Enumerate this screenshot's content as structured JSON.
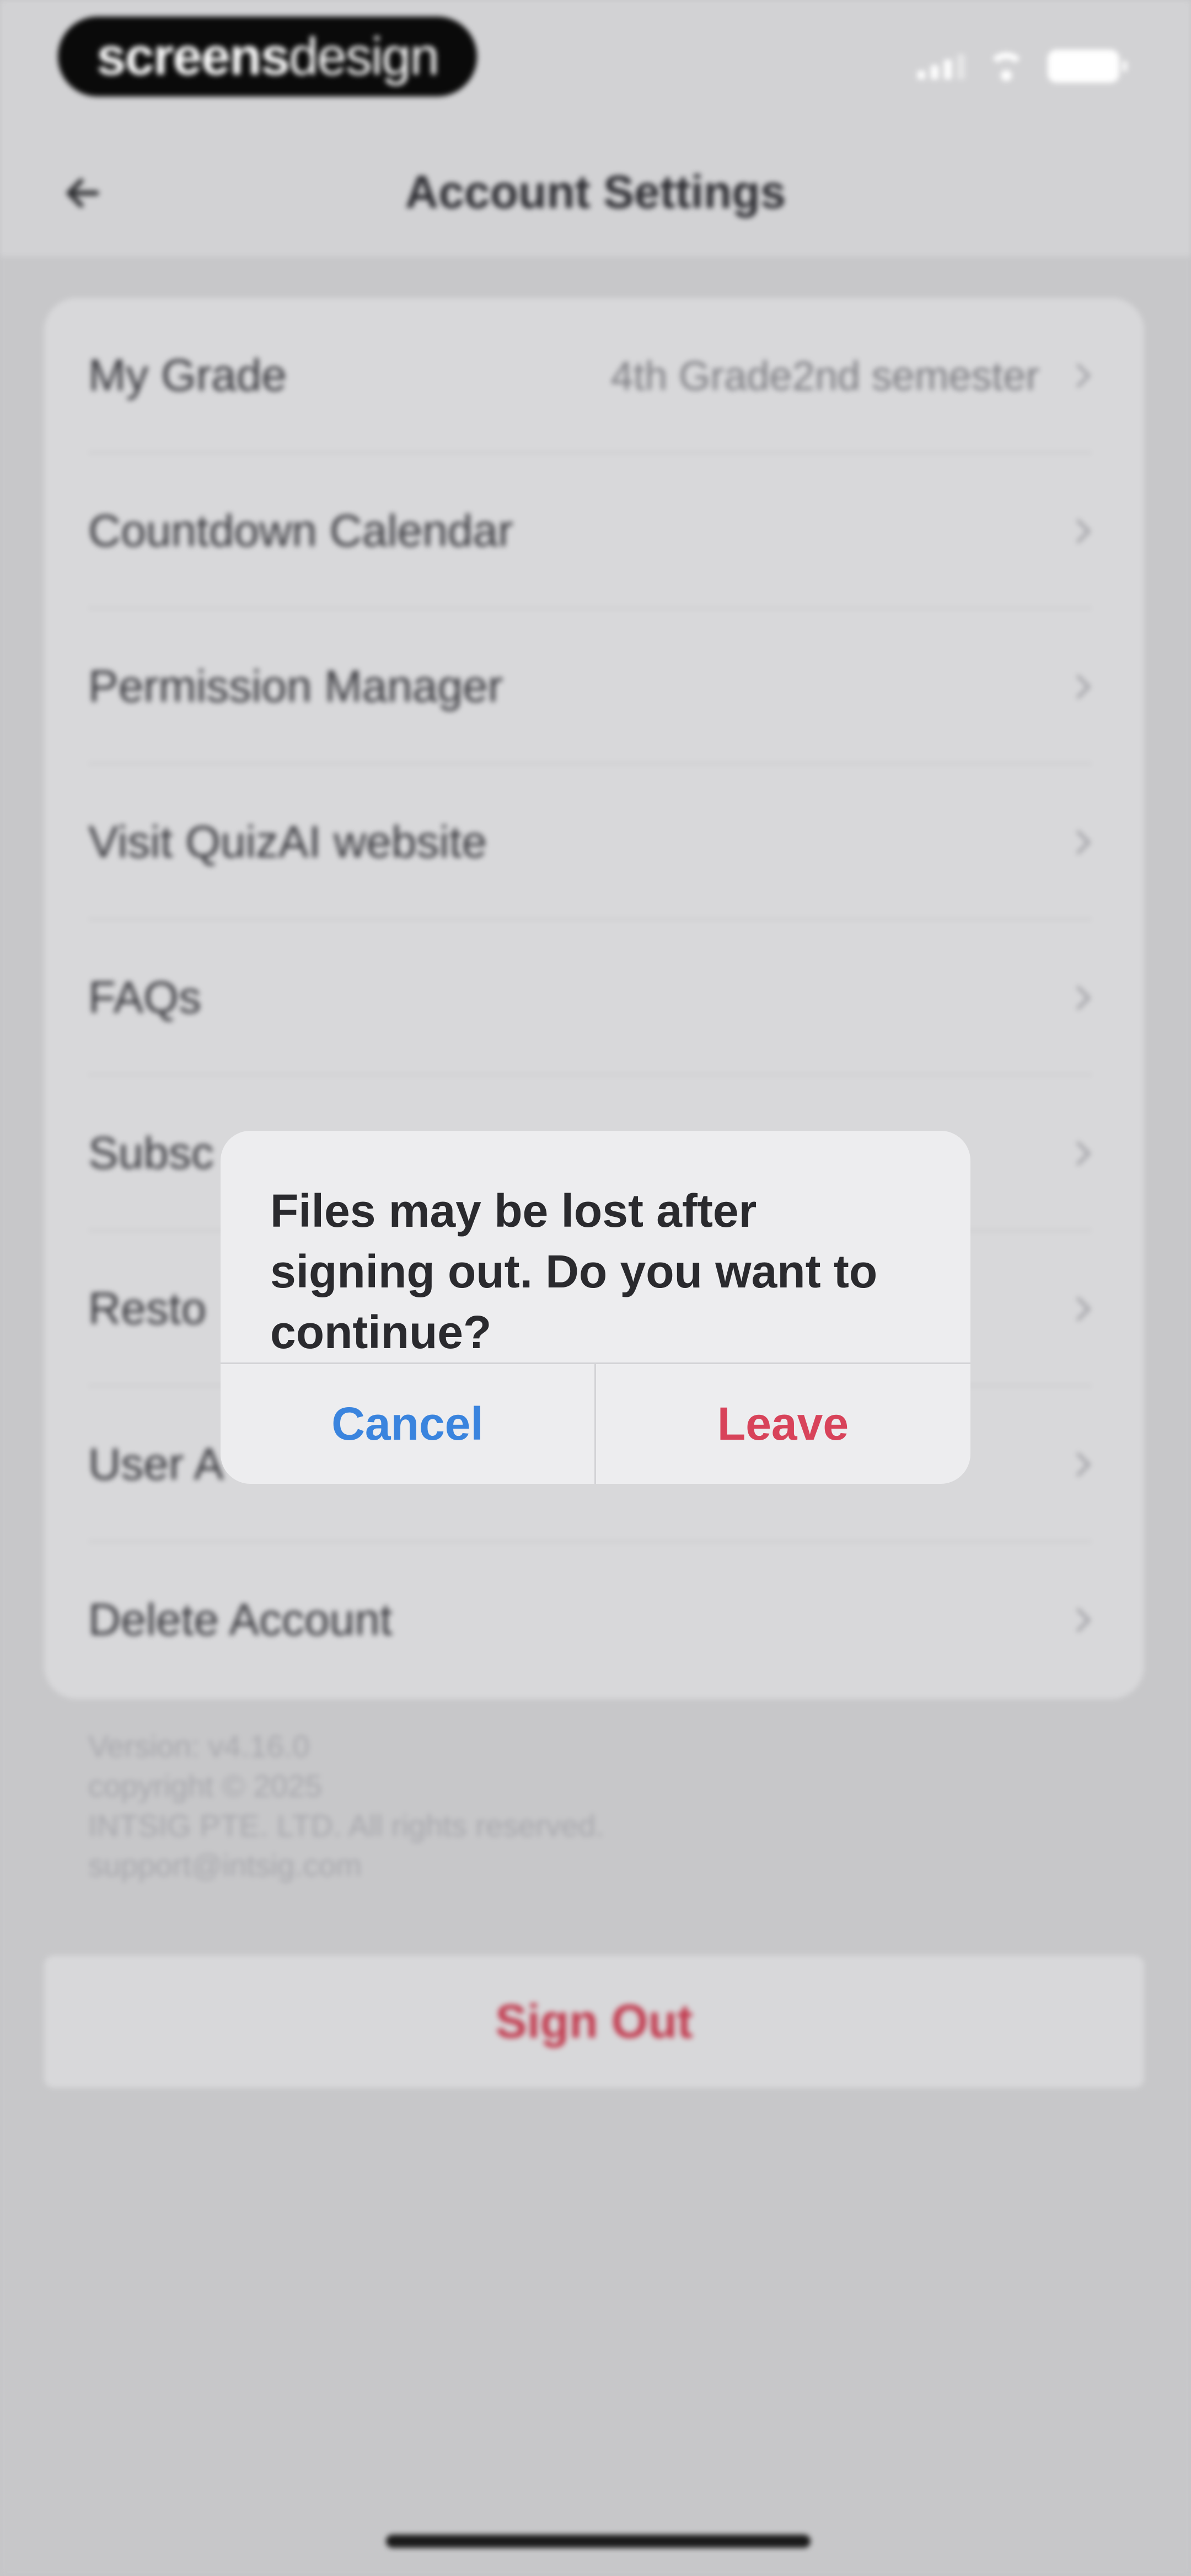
{
  "status_bar": {
    "brand_text_bold": "screens",
    "brand_text_light": "design"
  },
  "header": {
    "title": "Account Settings"
  },
  "settings": {
    "items": [
      {
        "label": "My Grade",
        "value": "4th Grade2nd semester"
      },
      {
        "label": "Countdown Calendar",
        "value": ""
      },
      {
        "label": "Permission Manager",
        "value": ""
      },
      {
        "label": "Visit QuizAI website",
        "value": ""
      },
      {
        "label": "FAQs",
        "value": ""
      },
      {
        "label": "Subsc",
        "value": ""
      },
      {
        "label": "Resto",
        "value": ""
      },
      {
        "label": "User A",
        "value": ""
      },
      {
        "label": "Delete Account",
        "value": ""
      }
    ]
  },
  "footer": {
    "version": "Version: v4.16.0",
    "copyright": "copyright © 2025",
    "company": "INTSIG PTE. LTD. All rights reserved.",
    "email": "support@intsig.com"
  },
  "sign_out_label": "Sign Out",
  "dialog": {
    "message": "Files may be lost after signing out. Do you want to continue?",
    "cancel_label": "Cancel",
    "leave_label": "Leave"
  },
  "colors": {
    "cancel": "#3a84de",
    "destructive": "#d8435a",
    "sign_out": "#c23a4e"
  }
}
